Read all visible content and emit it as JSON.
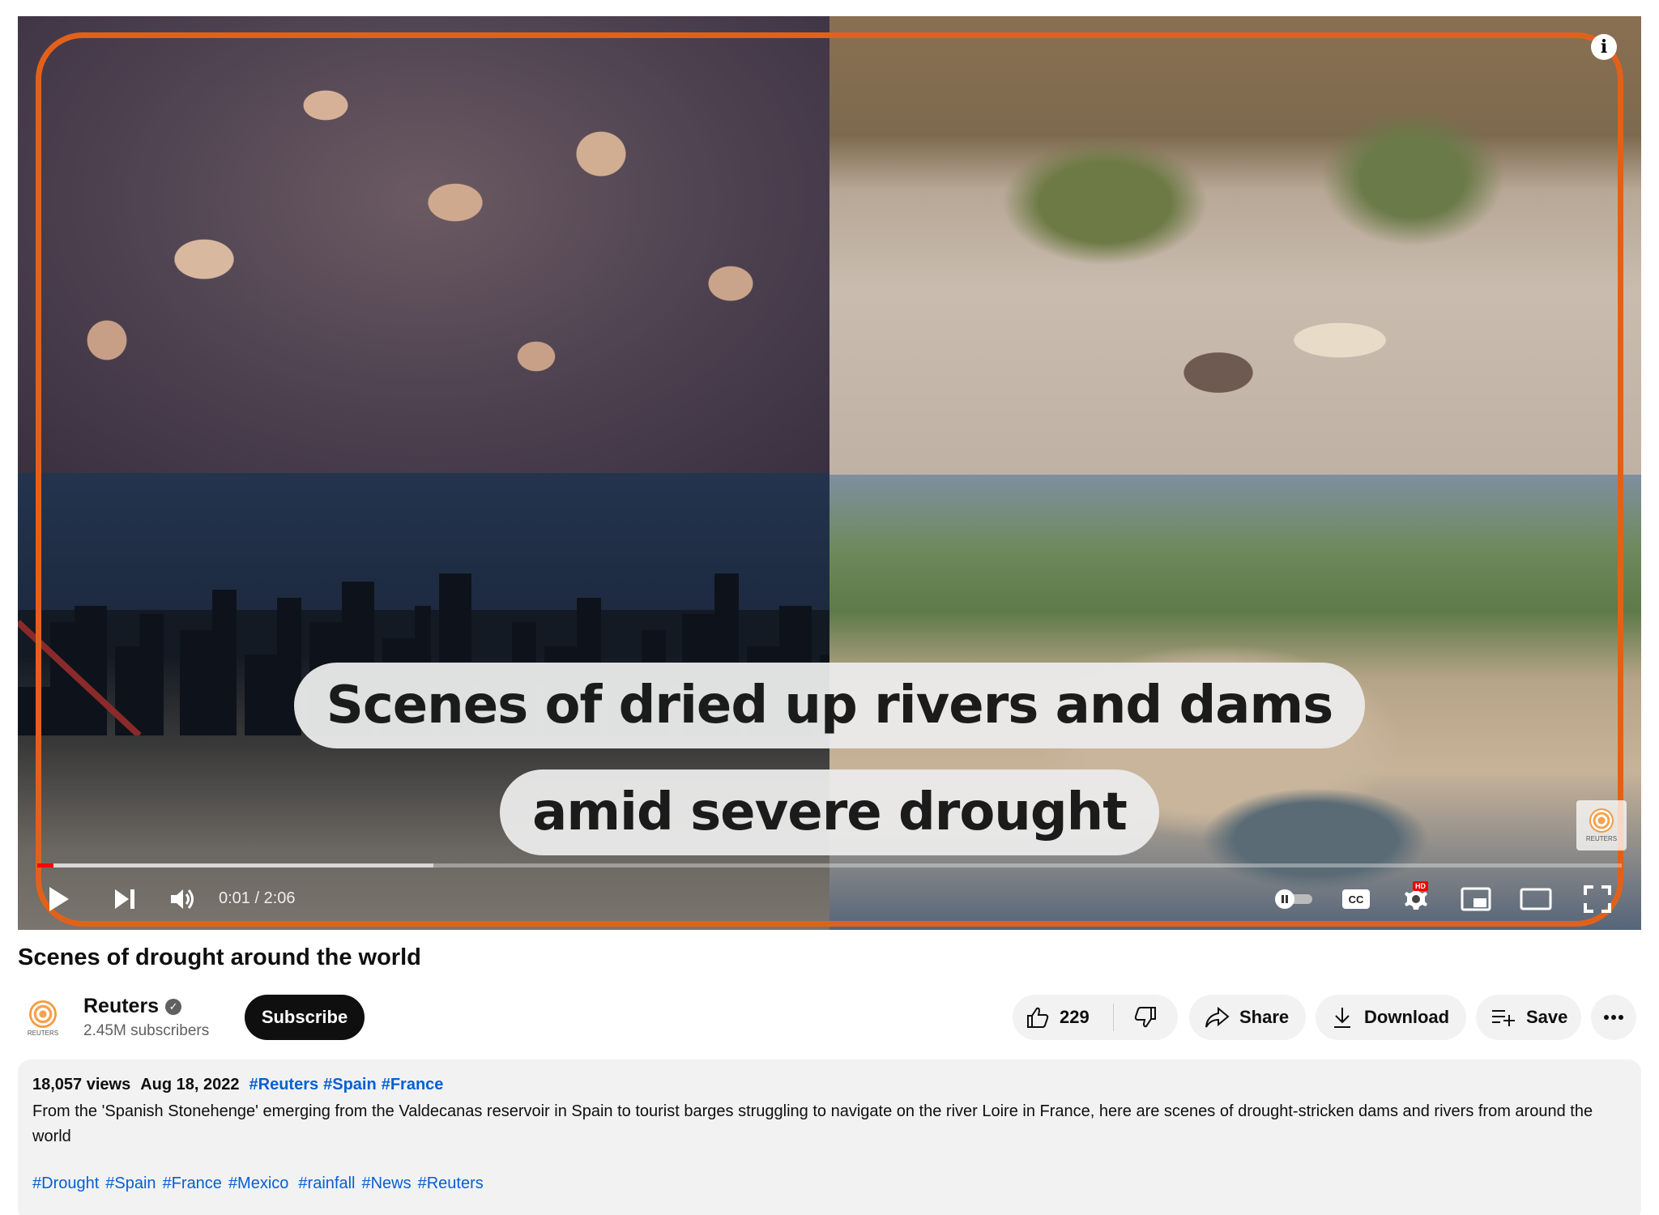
{
  "player": {
    "caption_line1": "Scenes of dried up rivers and dams",
    "caption_line2": "amid severe drought",
    "watermark": "REUTERS",
    "time_current": "0:01",
    "time_total": "2:06",
    "time_display": "0:01 / 2:06",
    "progress_played_pct": 1,
    "progress_loaded_pct": 25,
    "hd_badge": "HD",
    "icons": [
      "play-icon",
      "next-icon",
      "volume-icon",
      "autoplay-toggle-icon",
      "cc-icon",
      "settings-icon",
      "miniplayer-icon",
      "theater-icon",
      "fullscreen-icon",
      "info-icon"
    ],
    "accent_color": "#e2611a",
    "progress_color": "#ff0000"
  },
  "video": {
    "title": "Scenes of drought around the world"
  },
  "channel": {
    "name": "Reuters",
    "avatar_text": "REUTERS",
    "subscribers": "2.45M subscribers",
    "subscribe_label": "Subscribe"
  },
  "actions": {
    "like_count": "229",
    "share_label": "Share",
    "download_label": "Download",
    "save_label": "Save"
  },
  "description": {
    "views": "18,057 views",
    "date": "Aug 18, 2022",
    "top_tags": [
      "#Reuters",
      "#Spain",
      "#France"
    ],
    "text": "From the 'Spanish Stonehenge' emerging from the Valdecanas reservoir in Spain to tourist barges struggling to navigate on the river Loire in France, here are scenes of drought-stricken dams and rivers from around the world",
    "hashtags": [
      "#Drought",
      "#Spain",
      "#France",
      "#Mexico",
      "#rainfall",
      "#News",
      "#Reuters"
    ]
  }
}
